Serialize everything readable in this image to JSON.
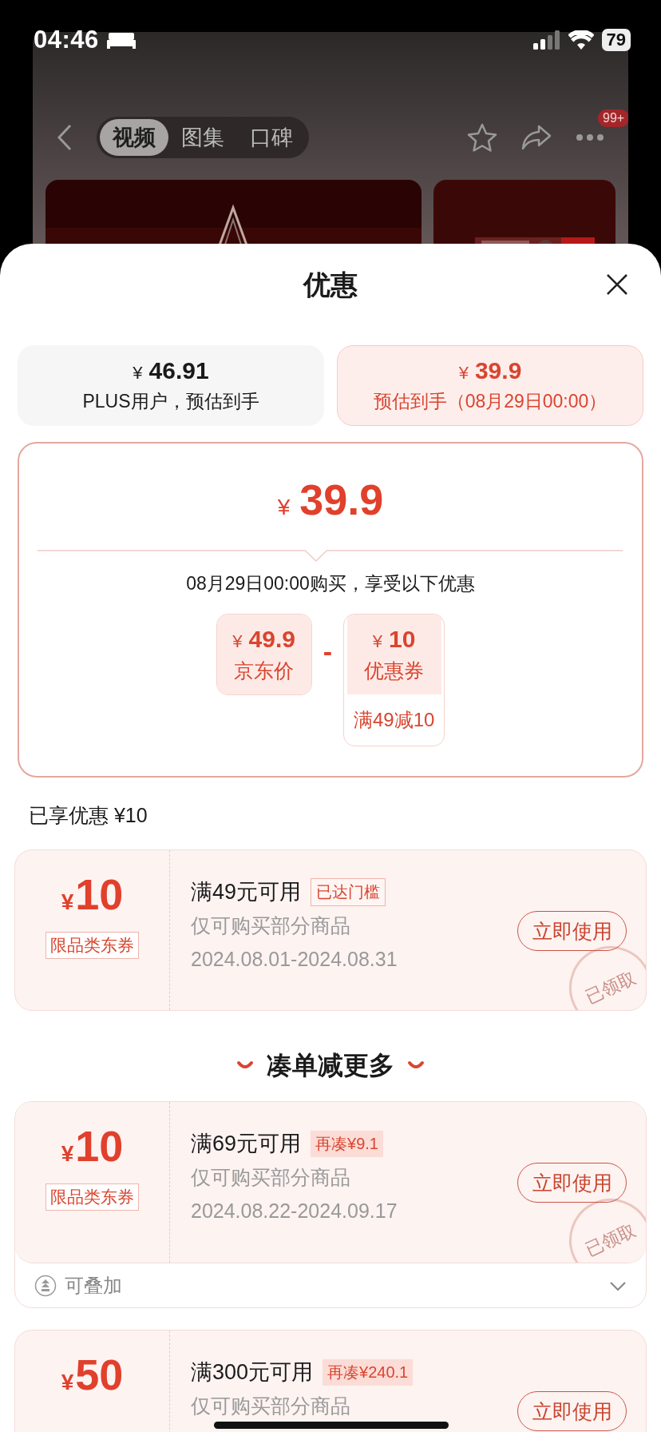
{
  "status_bar": {
    "time": "04:46",
    "battery": "79"
  },
  "background_page": {
    "tabs": [
      {
        "label": "视频",
        "selected": true
      },
      {
        "label": "图集",
        "selected": false
      },
      {
        "label": "口碑",
        "selected": false
      }
    ],
    "more_badge": "99+"
  },
  "sheet": {
    "title": "优惠"
  },
  "price_options": [
    {
      "currency": "¥",
      "price": "46.91",
      "label": "PLUS用户，预估到手",
      "selected": false
    },
    {
      "currency": "¥",
      "price": "39.9",
      "label": "预估到手（08月29日00:00）",
      "selected": true
    }
  ],
  "breakdown": {
    "currency": "¥",
    "price": "39.9",
    "note": "08月29日00:00购买，享受以下优惠",
    "operator": "-",
    "items": [
      {
        "currency": "¥",
        "amount": "49.9",
        "label": "京东价"
      },
      {
        "currency": "¥",
        "amount": "10",
        "label": "优惠券",
        "condition": "满49减10"
      }
    ]
  },
  "saved": "已享优惠 ¥10",
  "claimed_coupons": [
    {
      "currency": "¥",
      "amount": "10",
      "category": "限品类东券",
      "threshold": "满49元可用",
      "badge": {
        "text": "已达门槛",
        "kind": "reached"
      },
      "scope": "仅可购买部分商品",
      "validity": "2024.08.01-2024.08.31",
      "action": "立即使用",
      "stamp": "已领取"
    }
  ],
  "section_heading": "凑单减更多",
  "more_coupons": [
    {
      "currency": "¥",
      "amount": "10",
      "category": "限品类东券",
      "threshold": "满69元可用",
      "badge": {
        "text": "再凑¥9.1",
        "kind": "gap"
      },
      "scope": "仅可购买部分商品",
      "validity": "2024.08.22-2024.09.17",
      "action": "立即使用",
      "stamp": "已领取",
      "footer": {
        "label": "可叠加",
        "expanded": false
      }
    },
    {
      "currency": "¥",
      "amount": "50",
      "threshold": "满300元可用",
      "badge": {
        "text": "再凑¥240.1",
        "kind": "gap"
      },
      "scope": "仅可购买部分商品",
      "action": "立即使用"
    }
  ]
}
